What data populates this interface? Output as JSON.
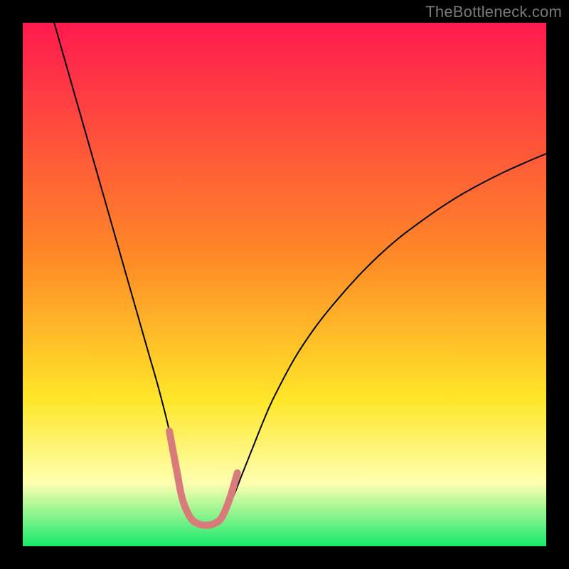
{
  "watermark": "TheBottleneck.com",
  "chart_data": {
    "type": "line",
    "title": "",
    "xlabel": "",
    "ylabel": "",
    "xlim": [
      0,
      100
    ],
    "ylim": [
      0,
      100
    ],
    "axes_visible": false,
    "grid": false,
    "background_gradient": {
      "top_color": "#ff1a4f",
      "mid1_color": "#ff8a27",
      "mid2_color": "#ffe629",
      "pale_band_color": "#ffffb0",
      "bottom_color": "#17e86b"
    },
    "series": [
      {
        "name": "bottleneck-curve",
        "color": "#000000",
        "stroke_width": 2,
        "x": [
          6,
          8,
          10,
          12,
          14,
          16,
          18,
          20,
          22,
          24,
          26,
          28,
          29.5,
          30.5,
          32,
          33.5,
          35,
          36.5,
          38,
          40,
          42,
          44,
          46,
          48,
          52,
          56,
          60,
          64,
          68,
          72,
          76,
          80,
          84,
          88,
          92,
          96,
          100
        ],
        "y": [
          100,
          93,
          86,
          79,
          72,
          65,
          58,
          51,
          44,
          37,
          30,
          22,
          14,
          9,
          5.5,
          4.3,
          4.0,
          4.3,
          5.5,
          9,
          14,
          19,
          24,
          28.5,
          36,
          42,
          47,
          51.5,
          55.5,
          59,
          62,
          64.8,
          67.3,
          69.5,
          71.5,
          73.3,
          75
        ]
      },
      {
        "name": "highlight-band",
        "color": "#d97b7b",
        "stroke_width": 10,
        "linecap": "round",
        "x": [
          28.0,
          29.5,
          30.5,
          32.0,
          33.5,
          35.0,
          36.5,
          38.0,
          39.5,
          41.0
        ],
        "y": [
          22.0,
          14.0,
          9.0,
          5.5,
          4.3,
          4.0,
          4.3,
          5.5,
          9.0,
          14.0
        ]
      }
    ]
  }
}
